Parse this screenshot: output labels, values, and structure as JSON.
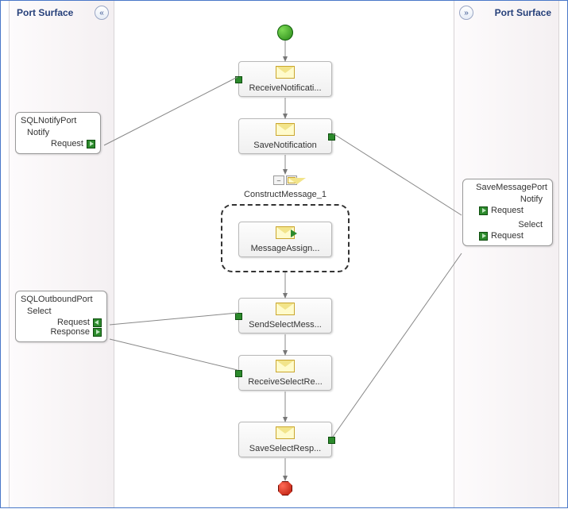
{
  "panels": {
    "left_title": "Port Surface",
    "right_title": "Port Surface"
  },
  "portsLeft": {
    "notify": {
      "name": "SQLNotifyPort",
      "op": "Notify",
      "msg1": "Request"
    },
    "outbound": {
      "name": "SQLOutboundPort",
      "op": "Select",
      "msg1": "Request",
      "msg2": "Response"
    }
  },
  "portsRight": {
    "save": {
      "name": "SaveMessagePort",
      "op1": "Notify",
      "op1_msg": "Request",
      "op2": "Select",
      "op2_msg": "Request"
    }
  },
  "activities": {
    "receiveNotification": "ReceiveNotificati...",
    "saveNotification": "SaveNotification",
    "constructTitle": "ConstructMessage_1",
    "messageAssign": "MessageAssign...",
    "sendSelect": "SendSelectMess...",
    "receiveSelect": "ReceiveSelectRe...",
    "saveSelectResp": "SaveSelectResp..."
  }
}
